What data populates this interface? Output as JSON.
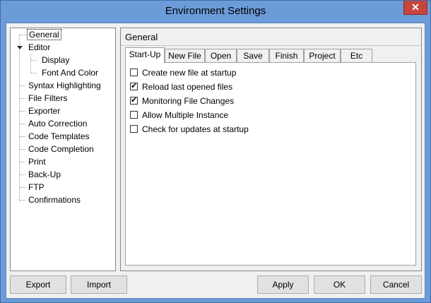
{
  "window": {
    "title": "Environment Settings",
    "close_glyph": "✕"
  },
  "tree": {
    "items": [
      {
        "label": "General"
      },
      {
        "label": "Editor"
      },
      {
        "label": "Display"
      },
      {
        "label": "Font And Color"
      },
      {
        "label": "Syntax Highlighting"
      },
      {
        "label": "File Filters"
      },
      {
        "label": "Exporter"
      },
      {
        "label": "Auto Correction"
      },
      {
        "label": "Code Templates"
      },
      {
        "label": "Code Completion"
      },
      {
        "label": "Print"
      },
      {
        "label": "Back-Up"
      },
      {
        "label": "FTP"
      },
      {
        "label": "Confirmations"
      }
    ],
    "selected": "General"
  },
  "panel": {
    "title": "General",
    "tabs": [
      {
        "label": "Start-Up"
      },
      {
        "label": "New File"
      },
      {
        "label": "Open"
      },
      {
        "label": "Save"
      },
      {
        "label": "Finish"
      },
      {
        "label": "Project"
      },
      {
        "label": "Etc"
      }
    ],
    "active_tab": "Start-Up",
    "options": [
      {
        "label": "Create new file at startup",
        "checked": false
      },
      {
        "label": "Reload last opened files",
        "checked": true
      },
      {
        "label": "Monitoring File Changes",
        "checked": true
      },
      {
        "label": "Allow Multiple Instance",
        "checked": false
      },
      {
        "label": "Check for updates at startup",
        "checked": false
      }
    ]
  },
  "buttons": {
    "export": "Export",
    "import": "Import",
    "apply": "Apply",
    "ok": "OK",
    "cancel": "Cancel"
  }
}
